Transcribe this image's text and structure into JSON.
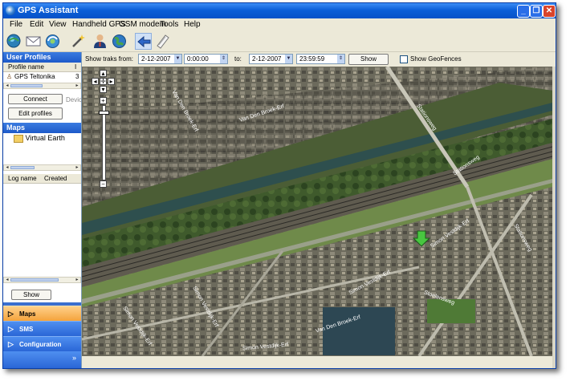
{
  "window": {
    "title": "GPS Assistant"
  },
  "menu": [
    "File",
    "Edit",
    "View",
    "Handheld GPS",
    "GSM modem",
    "Tools",
    "Help"
  ],
  "toolbar_icons": [
    "globe-icon",
    "mail-icon",
    "refresh-globe-icon",
    "wand-icon",
    "user-icon",
    "earth-icon",
    "arrow-icon",
    "note-icon"
  ],
  "sidebar": {
    "user_profiles_header": "User Profiles",
    "profile_column": "Profile name",
    "profile_column_extra": "I",
    "profile_row": {
      "name": "GPS Teltonika",
      "value": "3"
    },
    "connect_label": "Connect",
    "device_label": "Devic",
    "edit_profiles_label": "Edit profiles",
    "maps_header": "Maps",
    "maps_item": "Virtual Earth",
    "log_name_column": "Log name",
    "created_column": "Created",
    "show_label": "Show",
    "nav": [
      {
        "label": "Maps",
        "active": true
      },
      {
        "label": "SMS",
        "active": false
      },
      {
        "label": "Configuration",
        "active": false
      }
    ]
  },
  "filter": {
    "show_tracks_from_label": "Show traks from:",
    "from_date": "2-12-2007",
    "from_time": "0:00:00",
    "to_label": "to:",
    "to_date": "2-12-2007",
    "to_time": "23:59:59",
    "show_button": "Show",
    "geofences_label": "Show GeoFences",
    "geofences_checked": false
  },
  "map": {
    "street_labels": [
      "Van Den Broek-Erf",
      "Van Den Broek-Erf",
      "Simon Vestdijk-Erf",
      "Simon Vestdijk-Erf",
      "Simon Vestdijk-Erf",
      "Simon Vestdijk-Erf",
      "Van Den Broek-Erf",
      "Simon Vestdijk-Erf",
      "Stationsweg",
      "Stationsweg",
      "Stationsweg",
      "Stoelensweg"
    ],
    "marker": "location-arrow-icon"
  }
}
